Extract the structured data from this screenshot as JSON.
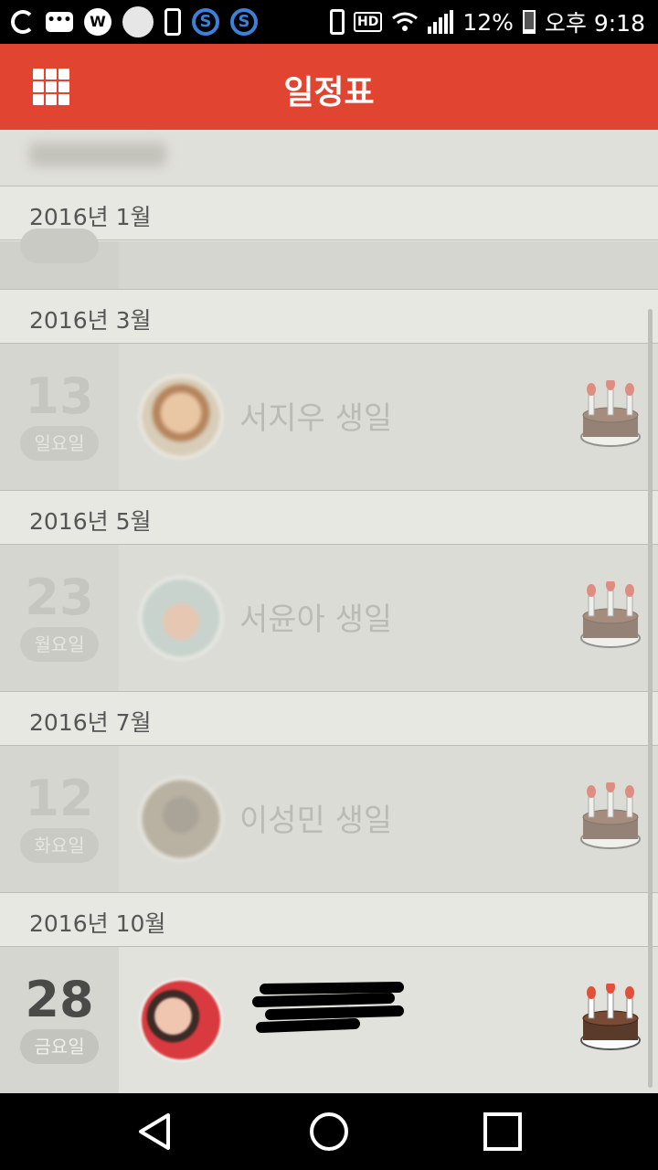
{
  "status_bar": {
    "icons_left": [
      "app-g-icon",
      "talk-icon",
      "w-icon",
      "circle-icon",
      "phone-icon",
      "s-app-icon",
      "s-app-icon"
    ],
    "talk_badge": "•••",
    "w_badge": "W",
    "s_badge": "S",
    "hd_badge": "HD",
    "battery": "12%",
    "time": "오후 9:18"
  },
  "app_bar": {
    "title": "일정표",
    "menu_icon": "grid-menu-icon",
    "color": "#e14431"
  },
  "months": [
    {
      "label": "2016년 1월"
    },
    {
      "label": "2016년 3월"
    },
    {
      "label": "2016년 5월"
    },
    {
      "label": "2016년 7월"
    },
    {
      "label": "2016년 10월"
    }
  ],
  "events": [
    {
      "day": "13",
      "weekday": "일요일",
      "name": "서지우 생일",
      "icon": "birthday-cake-icon"
    },
    {
      "day": "23",
      "weekday": "월요일",
      "name": "서윤아 생일",
      "icon": "birthday-cake-icon"
    },
    {
      "day": "12",
      "weekday": "화요일",
      "name": "이성민 생일",
      "icon": "birthday-cake-icon"
    },
    {
      "day": "28",
      "weekday": "금요일",
      "name": "",
      "icon": "birthday-cake-icon"
    }
  ],
  "nav_bar": {
    "buttons": [
      "back-icon",
      "home-icon",
      "recents-icon"
    ]
  }
}
